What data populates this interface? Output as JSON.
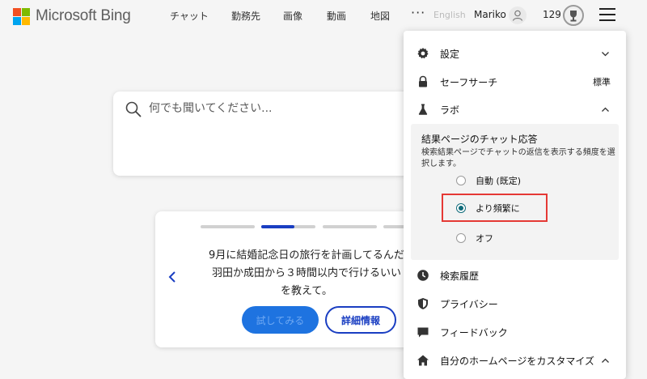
{
  "header": {
    "brand": "Microsoft Bing",
    "nav": [
      "チャット",
      "勤務先",
      "画像",
      "動画",
      "地図"
    ],
    "more": "···",
    "language": "English",
    "user_name": "Mariko",
    "points": "129"
  },
  "search": {
    "placeholder": "何でも聞いてください..."
  },
  "carousel": {
    "lines": [
      "9月に結婚記念日の旅行を計画してるんだ",
      "羽田か成田から３時間以内で行けるいい",
      "を教えて。"
    ],
    "try_label": "試してみる",
    "details_label": "詳細情報"
  },
  "menu": {
    "settings": "設定",
    "safesearch": "セーフサーチ",
    "safesearch_value": "標準",
    "labs": "ラボ",
    "labs_panel": {
      "title": "結果ページのチャット応答",
      "description": "検索結果ページでチャットの返信を表示する頻度を選択します。",
      "options": [
        {
          "label": "自動 (既定)",
          "checked": false
        },
        {
          "label": "より頻繁に",
          "checked": true
        },
        {
          "label": "オフ",
          "checked": false
        }
      ]
    },
    "history": "検索履歴",
    "privacy": "プライバシー",
    "feedback": "フィードバック",
    "customize": "自分のホームページをカスタマイズ"
  },
  "colors": {
    "accent": "#1a3ec2",
    "radio_selected": "#0f6b7a",
    "highlight": "#e53935"
  }
}
